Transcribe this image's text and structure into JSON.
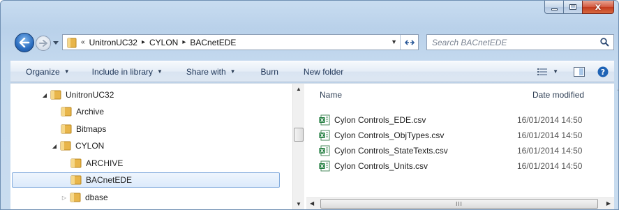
{
  "window": {
    "caption_buttons": [
      "minimize",
      "maximize",
      "close"
    ],
    "close_glyph": "x"
  },
  "address": {
    "overflow": "«",
    "crumbs": [
      "UnitronUC32",
      "CYLON",
      "BACnetEDE"
    ],
    "separator": "▸"
  },
  "search": {
    "placeholder": "Search BACnetEDE"
  },
  "commands": {
    "organize": "Organize",
    "include": "Include in library",
    "share": "Share with",
    "burn": "Burn",
    "new_folder": "New folder"
  },
  "tree": {
    "items": [
      {
        "label": "UnitronUC32",
        "expanded": true
      },
      {
        "label": "Archive"
      },
      {
        "label": "Bitmaps"
      },
      {
        "label": "CYLON",
        "expanded": true
      },
      {
        "label": "ARCHIVE"
      },
      {
        "label": "BACnetEDE",
        "selected": true
      },
      {
        "label": "dbase",
        "expanded": false
      }
    ]
  },
  "files": {
    "columns": {
      "name": "Name",
      "date": "Date modified"
    },
    "rows": [
      {
        "name": "Cylon Controls_EDE.csv",
        "date": "16/01/2014 14:50"
      },
      {
        "name": "Cylon Controls_ObjTypes.csv",
        "date": "16/01/2014 14:50"
      },
      {
        "name": "Cylon Controls_StateTexts.csv",
        "date": "16/01/2014 14:50"
      },
      {
        "name": "Cylon Controls_Units.csv",
        "date": "16/01/2014 14:50"
      }
    ],
    "hscroll_grip": "III"
  },
  "colors": {
    "frame": "#b9d1ea",
    "selection_border": "#84acdd",
    "folder": "#e8b54a",
    "excel_green": "#1e7b3c"
  }
}
